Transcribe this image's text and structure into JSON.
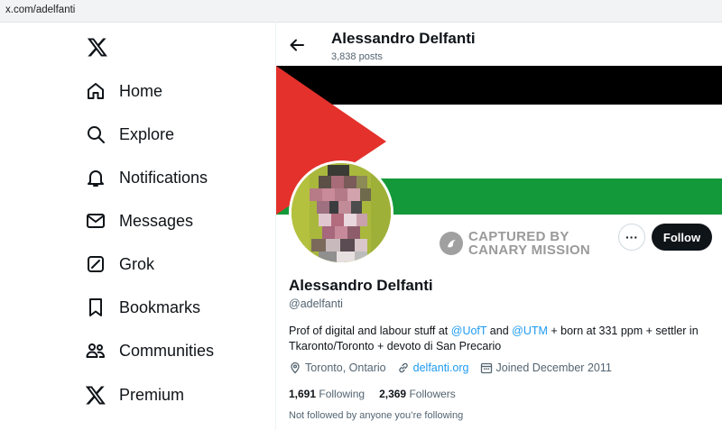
{
  "browser": {
    "url": "x.com/adelfanti"
  },
  "sidebar": {
    "logo_icon": "x-logo-icon",
    "items": [
      {
        "label": "Home",
        "icon": "home-icon"
      },
      {
        "label": "Explore",
        "icon": "search-icon"
      },
      {
        "label": "Notifications",
        "icon": "bell-icon"
      },
      {
        "label": "Messages",
        "icon": "envelope-icon"
      },
      {
        "label": "Grok",
        "icon": "grok-icon"
      },
      {
        "label": "Bookmarks",
        "icon": "bookmark-icon"
      },
      {
        "label": "Communities",
        "icon": "people-icon"
      },
      {
        "label": "Premium",
        "icon": "x-logo-icon"
      }
    ]
  },
  "header": {
    "name": "Alessandro Delfanti",
    "posts": "3,838 posts"
  },
  "banner": {
    "colors": {
      "black": "#000000",
      "white": "#ffffff",
      "green": "#14993a",
      "red": "#e4312b"
    }
  },
  "watermark": {
    "line1": "CAPTURED BY",
    "line2": "CANARY MISSION"
  },
  "actions": {
    "more_label": "···",
    "follow_label": "Follow"
  },
  "profile": {
    "name": "Alessandro Delfanti",
    "handle": "@adelfanti",
    "bio": {
      "p1": "Prof of digital and labour stuff at ",
      "m1": "@UofT",
      "p2": " and ",
      "m2": "@UTM",
      "p3": " + born at 331 ppm + settler in Tkaronto/Toronto + devoto di San Precario"
    },
    "location": "Toronto, Ontario",
    "website": "delfanti.org",
    "joined": "Joined December 2011",
    "following_count": "1,691",
    "following_label": "Following",
    "followers_count": "2,369",
    "followers_label": "Followers",
    "not_followed": "Not followed by anyone you’re following"
  },
  "colors": {
    "accent": "#1d9bf0",
    "text": "#0f1419",
    "secondary": "#536471"
  }
}
